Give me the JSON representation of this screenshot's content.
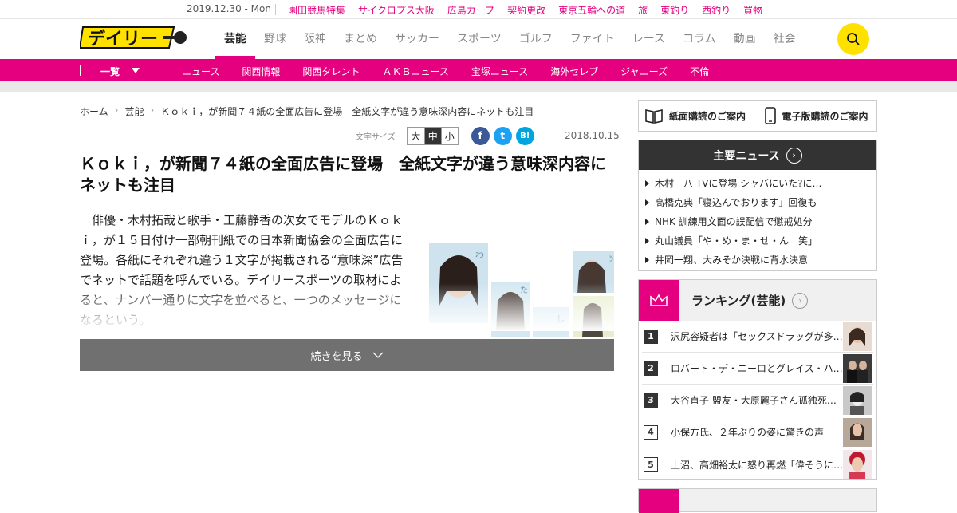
{
  "topbar": {
    "date": "2019.12.30 - Mon",
    "links": [
      "園田競馬特集",
      "サイクロプス大阪",
      "広島カープ",
      "契約更改",
      "東京五輪への道",
      "旅",
      "東釣り",
      "西釣り",
      "買物"
    ]
  },
  "header": {
    "logo_text": "デイリー",
    "nav": [
      "芸能",
      "野球",
      "阪神",
      "まとめ",
      "サッカー",
      "スポーツ",
      "ゴルフ",
      "ファイト",
      "レース",
      "コラム",
      "動画",
      "社会"
    ],
    "active_nav": "芸能"
  },
  "subnav": {
    "list_label": "一覧",
    "items": [
      "ニュース",
      "関西情報",
      "関西タレント",
      "ＡＫＢニュース",
      "宝塚ニュース",
      "海外セレブ",
      "ジャニーズ",
      "不倫"
    ]
  },
  "breadcrumb": [
    "ホーム",
    "芸能",
    "Ｋｏｋｉ，が新聞７４紙の全面広告に登場　全紙文字が違う意味深内容にネットも注目"
  ],
  "article": {
    "font_size_label": "文字サイズ",
    "font_sizes": [
      "大",
      "中",
      "小"
    ],
    "selected_font_size": "中",
    "share": [
      "f",
      "t",
      "B!"
    ],
    "date": "2018.10.15",
    "headline": "Ｋｏｋｉ，が新聞７４紙の全面広告に登場　全紙文字が違う意味深内容にネットも注目",
    "body": "俳優・木村拓哉と歌手・工藤静香の次女でモデルのＫｏｋｉ，が１５日付け一部朝刊紙での日本新聞協会の全面広告に登場。各紙にそれぞれ違う１文字が掲載される“意味深”広告でネットで話題を呼んでいる。デイリースポーツの取材によると、ナンバー通りに文字を並べると、一つのメッセージになるという。",
    "photo_chars": [
      "わ",
      "た",
      "し",
      "う"
    ],
    "read_more": "続きを見る"
  },
  "sidebar": {
    "subscribe_paper": "紙面購読のご案内",
    "subscribe_digital": "電子版購読のご案内",
    "news_title": "主要ニュース",
    "news": [
      "木村一八 TVに登場 シャバにいた?に…",
      "高橋克典「寝込んでおります」回復も",
      "NHK 訓練用文面の誤配信で懲戒処分",
      "丸山議員「や・め・ま・せ・ん　笑」",
      "井岡一翔、大みそか決戦に背水決意"
    ],
    "ranking_title": "ランキング(芸能)",
    "ranking": [
      {
        "rank": "1",
        "title": "沢尻容疑者は「セックスドラッグが多…"
      },
      {
        "rank": "2",
        "title": "ロバート・デ・ニーロとグレイス・ハ…"
      },
      {
        "rank": "3",
        "title": "大谷直子 盟友・大原麗子さん孤独死…"
      },
      {
        "rank": "4",
        "title": "小保方氏、２年ぶりの姿に驚きの声"
      },
      {
        "rank": "5",
        "title": "上沼、高畑裕太に怒り再燃「偉そうに…"
      }
    ]
  },
  "colors": {
    "brand_pink": "#e4007f",
    "logo_yellow": "#ffe100"
  }
}
